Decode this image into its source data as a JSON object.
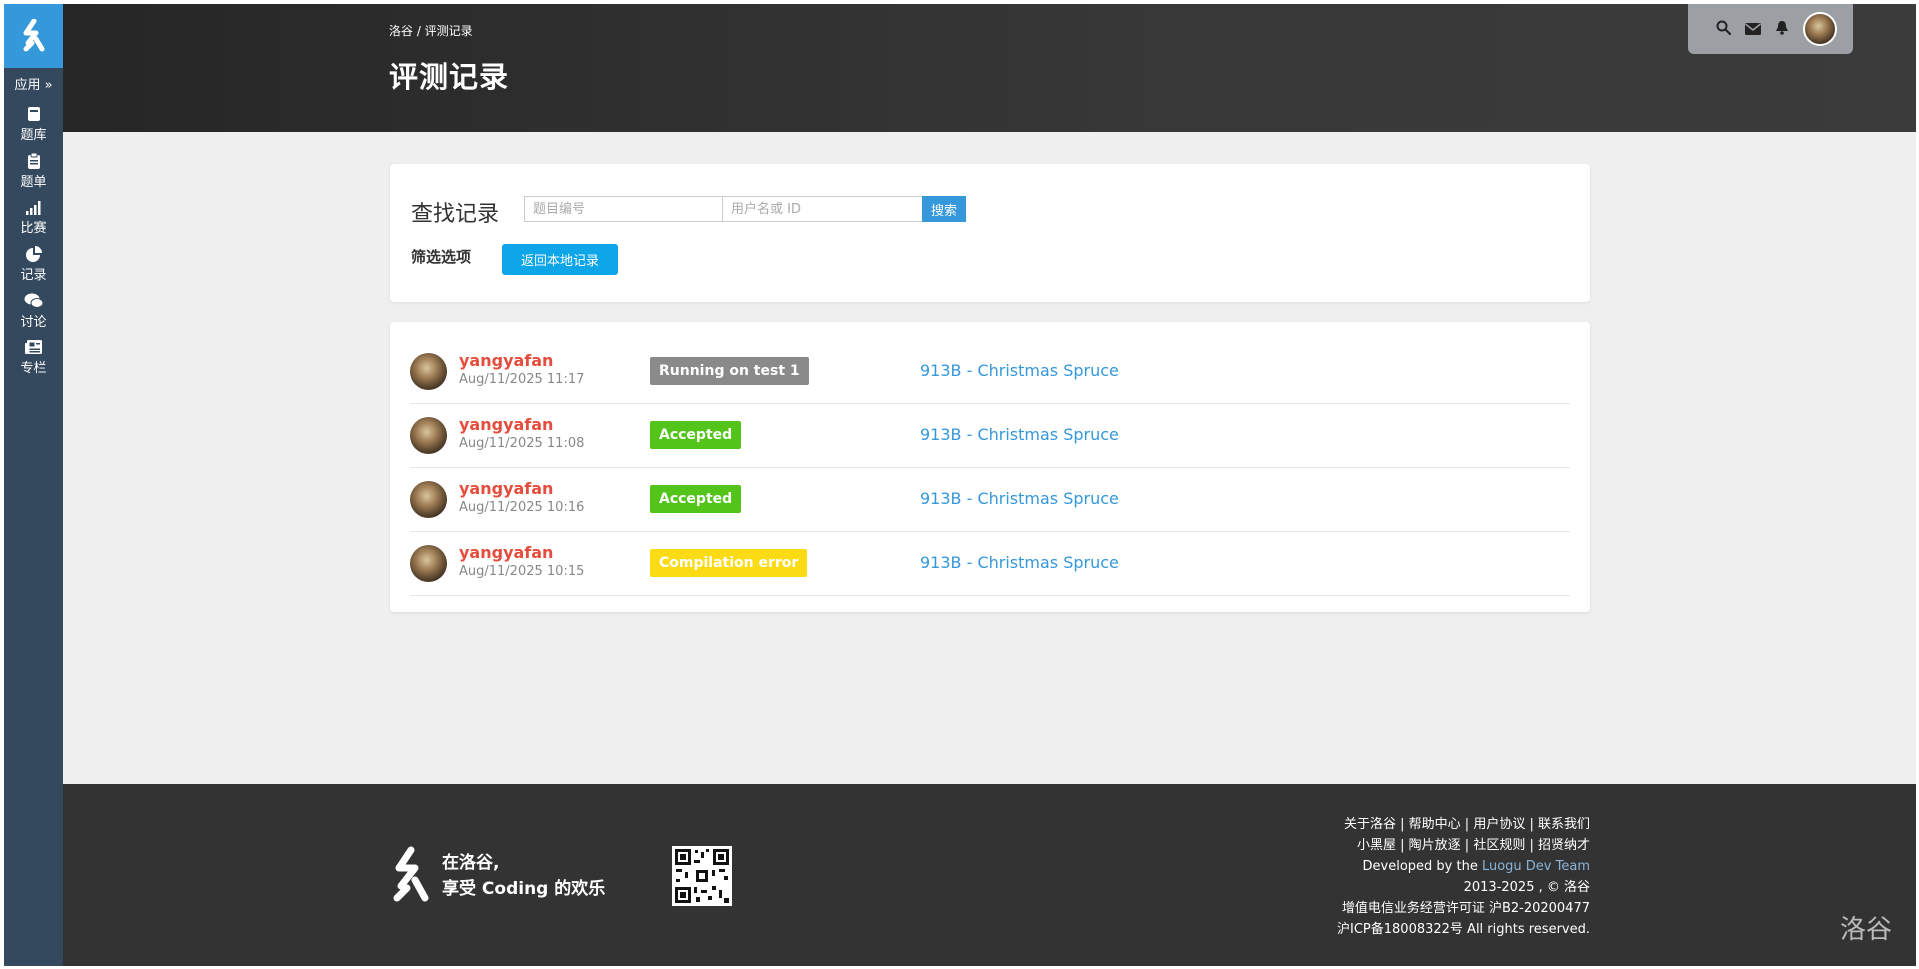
{
  "sidebar": {
    "apps_label": "应用 »",
    "items": [
      {
        "label": "题库",
        "icon": "book-icon"
      },
      {
        "label": "题单",
        "icon": "clipboard-icon"
      },
      {
        "label": "比赛",
        "icon": "signal-bars-icon"
      },
      {
        "label": "记录",
        "icon": "pie-chart-icon"
      },
      {
        "label": "讨论",
        "icon": "comments-icon"
      },
      {
        "label": "专栏",
        "icon": "newspaper-icon"
      }
    ]
  },
  "header": {
    "breadcrumb": "洛谷 / 评测记录",
    "title": "评测记录"
  },
  "search": {
    "title": "查找记录",
    "problem_placeholder": "题目编号",
    "user_placeholder": "用户名或 ID",
    "button": "搜索",
    "filter_label": "筛选选项",
    "local_button": "返回本地记录"
  },
  "records": [
    {
      "user": "yangyafan",
      "time": "Aug/11/2025 11:17",
      "status": "Running on test 1",
      "status_color": "#8a8a8a",
      "problem": "913B - Christmas Spruce"
    },
    {
      "user": "yangyafan",
      "time": "Aug/11/2025 11:08",
      "status": "Accepted",
      "status_color": "#52c41a",
      "problem": "913B - Christmas Spruce"
    },
    {
      "user": "yangyafan",
      "time": "Aug/11/2025 10:16",
      "status": "Accepted",
      "status_color": "#52c41a",
      "problem": "913B - Christmas Spruce"
    },
    {
      "user": "yangyafan",
      "time": "Aug/11/2025 10:15",
      "status": "Compilation error",
      "status_color": "#fadb14",
      "problem": "913B - Christmas Spruce"
    }
  ],
  "footer": {
    "slogan_line1": "在洛谷,",
    "slogan_line2": "享受 Coding 的欢乐",
    "links_row1": [
      "关于洛谷",
      "帮助中心",
      "用户协议",
      "联系我们"
    ],
    "links_row2": [
      "小黑屋",
      "陶片放逐",
      "社区规则",
      "招贤纳才"
    ],
    "developed_by": "Developed by the",
    "team": "Luogu Dev Team",
    "copyright": "2013-2025 , © 洛谷",
    "license": "增值电信业务经营许可证 沪B2-20200477",
    "icp": "沪ICP备18008322号 All rights reserved.",
    "corner": "洛谷"
  },
  "colors": {
    "sidebar": "#34495e",
    "logo_bg": "#3498db",
    "username": "#e74c3c",
    "link": "#3498db"
  }
}
